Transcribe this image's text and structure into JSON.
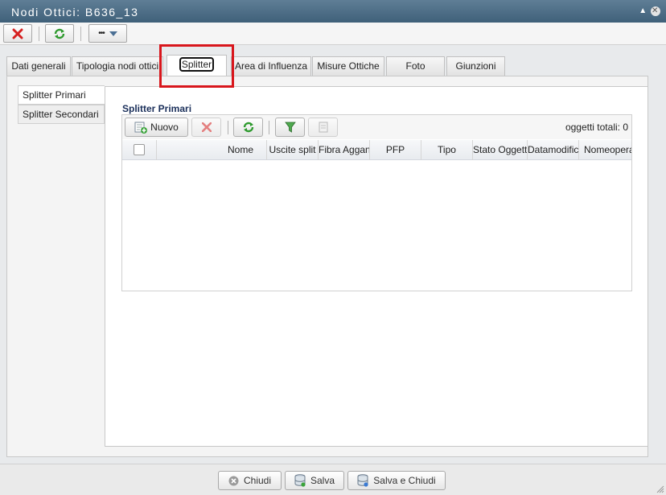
{
  "window": {
    "title": "Nodi Ottici: B636_13"
  },
  "toolbar": {
    "more_label": "•••"
  },
  "tabs": [
    {
      "label": "Dati generali"
    },
    {
      "label": "Tipologia nodi ottici"
    },
    {
      "label": "Splitter"
    },
    {
      "label": "Area di Influenza"
    },
    {
      "label": "Misure Ottiche"
    },
    {
      "label": "Foto"
    },
    {
      "label": "Giunzioni"
    }
  ],
  "active_tab": "Splitter",
  "subnav": [
    {
      "label": "Splitter Primari"
    },
    {
      "label": "Splitter Secondari"
    }
  ],
  "section": {
    "title": "Splitter Primari"
  },
  "grid": {
    "new_label": "Nuovo",
    "count_label": "oggetti totali: 0",
    "columns": [
      "Nome",
      "Uscite split",
      "Fibra Aggancio",
      "PFP",
      "Tipo",
      "Stato Oggetto",
      "Datamodifica",
      "Nomeoperatore"
    ]
  },
  "footer": {
    "close": "Chiudi",
    "save": "Salva",
    "save_close": "Salva e Chiudi"
  },
  "colors": {
    "titlebar": "#4a6a83",
    "highlight": "#d8161c",
    "delete": "#d62020",
    "refresh": "#2e9a2e"
  }
}
